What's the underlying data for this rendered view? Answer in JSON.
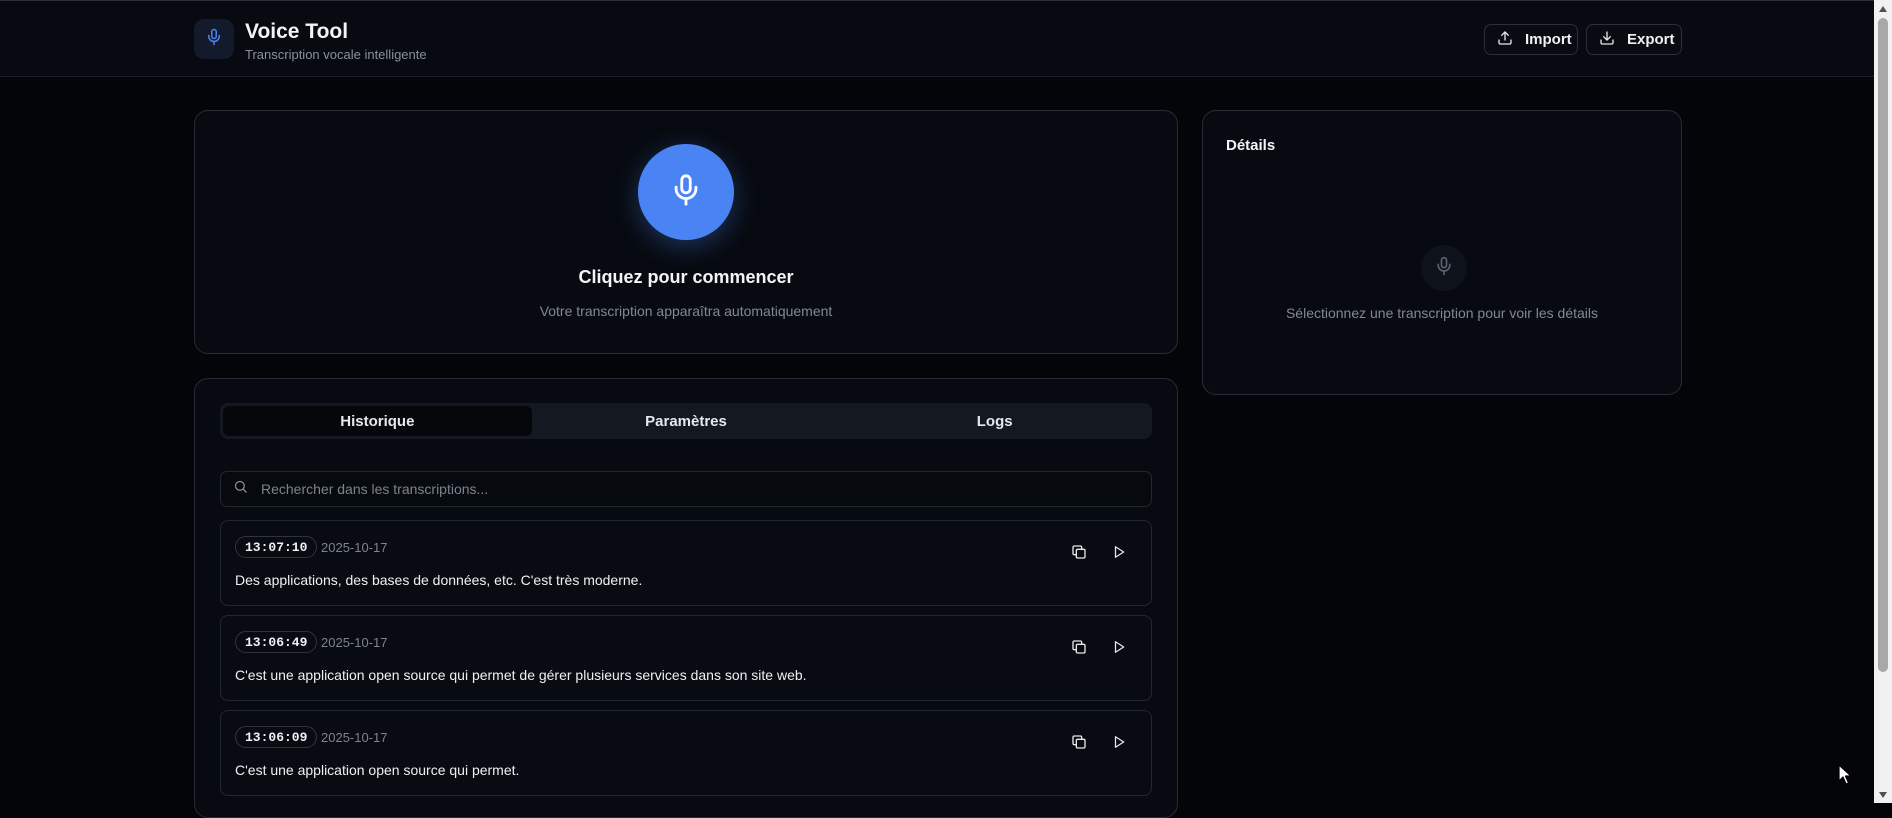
{
  "app": {
    "title": "Voice Tool",
    "subtitle": "Transcription vocale intelligente"
  },
  "header": {
    "import_label": "Import",
    "export_label": "Export"
  },
  "recorder": {
    "title": "Cliquez pour commencer",
    "subtitle": "Votre transcription apparaîtra automatiquement"
  },
  "details": {
    "title": "Détails",
    "empty_text": "Sélectionnez une transcription pour voir les détails"
  },
  "tabs": [
    {
      "label": "Historique",
      "active": true
    },
    {
      "label": "Paramètres",
      "active": false
    },
    {
      "label": "Logs",
      "active": false
    }
  ],
  "search": {
    "placeholder": "Rechercher dans les transcriptions...",
    "value": ""
  },
  "transcriptions": [
    {
      "time": "13:07:10",
      "date": "2025-10-17",
      "text": "Des applications, des bases de données, etc. C'est très moderne."
    },
    {
      "time": "13:06:49",
      "date": "2025-10-17",
      "text": "C'est une application open source qui permet de gérer plusieurs services dans son site web."
    },
    {
      "time": "13:06:09",
      "date": "2025-10-17",
      "text": "C'est une application open source qui permet."
    }
  ],
  "colors": {
    "accent": "#4a84f4",
    "background": "#030509",
    "card": "#070a10"
  },
  "icons": {
    "mic": "microphone-icon",
    "import": "upload-icon",
    "export": "download-icon",
    "search": "search-icon",
    "copy": "copy-icon",
    "play": "play-icon"
  }
}
